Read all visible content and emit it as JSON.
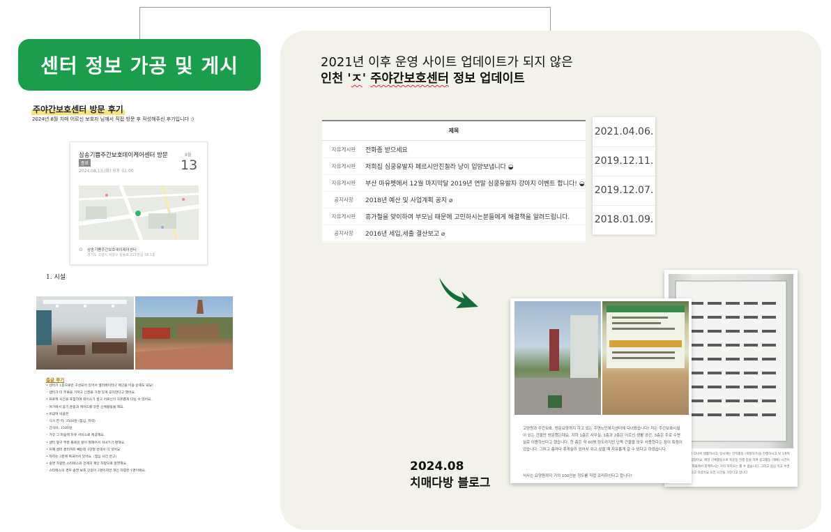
{
  "header": {
    "title": "센터 정보 가공 및 게시"
  },
  "blog": {
    "title": "주야간보호센터 방문 후기",
    "subtitle": "2024년 8월 치매 어르신 보호자 님께서 직접 방문 후 작성해주신 후기입니다 :)",
    "card": {
      "name": "삼송기쁨주간보호데이케어센터 방문",
      "badge": "종료",
      "datetime": "2024.08.13.(화) 오후 01:00",
      "month": "8월",
      "day": "13",
      "address_name": "삼송기쁨주간보호데이케어센터",
      "address_detail": "경기도 고양시 덕양구 삼송로 221번길 38 1층"
    },
    "section_title": "1. 시설",
    "review_heading": "총글 후기",
    "review_lines": [
      "• 센터가 1층으로만 구성되어 있어서 엘리베이터나 계단을 이용 안해도 되요!",
      "   ◦ 센터가 더 무료을 가져고 인권을 가졌 있게 공지한다고 했어요.",
      "• 프로젝 시간을 포함하여 데이스가 알고 어르신이 자유롭게 다닐 수 있어요.",
      "   ◦ 여가에서 공기 운동과 케어드를 같은 신체활동을 해요.",
      "• 비급여 비용은",
      "   ◦ 식사 한 끼: 3500원 (점심, 저녁)",
      "   ◦ 간식비: 1500원",
      "   ◦ 가장 그 마음에 자유 서비스로 제공해요.",
      "• 센터 앞구 부분 들로의 앞이 절해어서 자녀가기 편해요.",
      "• 지혜 센터 센터까지 빼는데 1만얼 반데서 더 넣어요.",
      "• 자리는 2분에 짜국어서 있어요. (점심 사전 완고)",
      "• 송영 차량은 스타렉스와 관계자 계인 차량으로 운영해요.",
      "   ◦ 스타렉스의 경우 송영 보호 인원이 2명이지만 개인 차량은 1명이에요."
    ]
  },
  "main": {
    "headline1": "2021년 이후 운영 사이트 업데이트가 되지 않은",
    "headline2_prefix": "인천 '",
    "headline2_squiggle1": "ㅈ",
    "headline2_mid": "' ",
    "headline2_squiggle2": "주야간보호센터",
    "headline2_suffix": " 정보 업데이트",
    "board": {
      "column_title": "제목",
      "rows": [
        {
          "category": "자유게시판",
          "title": "전화좀 받으세요"
        },
        {
          "category": "자유게시판",
          "title": "저희집 심쿵유발자 페르시안친칠라 냥이 입양보냅니다 ◒"
        },
        {
          "category": "자유게시판",
          "title": "부산 마유펫에서 12월 마지막달 2019년 연말 심쿵유발자 강아지 이벤트 합니다! ◒"
        },
        {
          "category": "공지사항",
          "title": "2018년 예산 및 사업계획 공지 ⌀"
        },
        {
          "category": "자유게시판",
          "title": "휴가철을 맞이하여 부모님 때문에 고민하시는분들에게 해결책을 알려드립니다."
        },
        {
          "category": "공지사항",
          "title": "2016년 세입,세출 결산보고 ⌀"
        }
      ],
      "dates": [
        "2021.04.06.",
        "2019.12.11.",
        "2019.12.07.",
        "2018.01.09."
      ]
    },
    "caption_line1": "2024.08",
    "caption_line2": "치매다방 블로그",
    "doc2": {
      "text": "고양원과 주간보호, 방문요양까지 하고 있는 주연노인복지센터에 다녀왔습니다! 저는 주간보호시설이 있는 건물만 방문했는데요. 지하 1층은 사무실, 1층과 2층은 어르신 생활 공간, 3층은 주로 수면실로 이용하신다고 했습니다. 한 층은 약 60평 정도라지만 단독 건물을 모두 사용한다는 점이 특징이었습니다. 그리고 층마다 휴게실이 있어서 쉬고 싶을 때 자유롭게 갈 수 있다고 하셨습니다.",
      "footer": "식사는 요양원까지 거의 100인분 정도를 직접 조리하신다고 합니다!"
    },
    "doc3": {
      "text": "센터에서 알린다 다녀서 생활하시고, 당시에는 인지활동 (색칠하기)을 진행하시고 보 1개씩 책상과 의자가 있었어요. 매일 신체활동으로 목운동 진행 등을 하여 중고활동 (레베) 시간이 있다고 하네요! 저울에서 함께하시는 거리 하지요는 활 수 없습니다. 그리고 점심 먹고 수면하는 시간이 있다고 하셨어요 오전 시간을 가진다고 합니다"
    }
  },
  "colors": {
    "brand_green": "#1b9e4b",
    "panel_bg": "#f2f2ea",
    "highlight_yellow": "#f7e37a",
    "arrow_green": "#136d3b"
  }
}
